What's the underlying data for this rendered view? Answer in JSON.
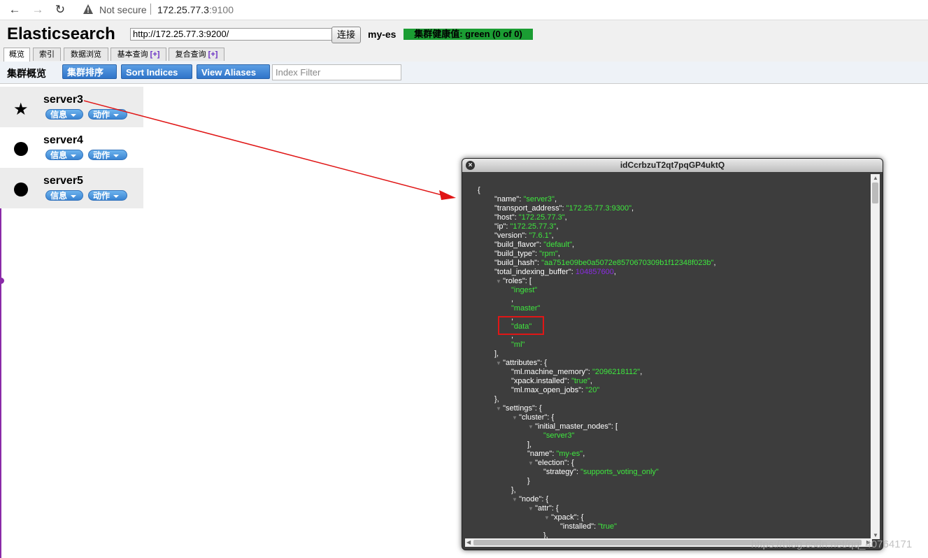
{
  "browser": {
    "security_label": "Not secure",
    "url_host": "172.25.77.3",
    "url_port": ":9100"
  },
  "header": {
    "title": "Elasticsearch",
    "connection_url": "http://172.25.77.3:9200/",
    "connect_label": "连接",
    "cluster_name": "my-es",
    "health": "集群健康值: green (0 of 0)"
  },
  "tabs": [
    {
      "label": "概览"
    },
    {
      "label": "索引"
    },
    {
      "label": "数据浏览"
    },
    {
      "label": "基本查询",
      "plus": "[+]"
    },
    {
      "label": "复合查询",
      "plus": "[+]"
    }
  ],
  "toolbar": {
    "title": "集群概览",
    "sort_cluster": "集群排序",
    "sort_indices": "Sort Indices",
    "view_aliases": "View Aliases",
    "filter_placeholder": "Index Filter"
  },
  "nodes": [
    {
      "name": "server3",
      "info": "信息",
      "action": "动作",
      "icon": "star-icon"
    },
    {
      "name": "server4",
      "info": "信息",
      "action": "动作",
      "icon": "circle-icon"
    },
    {
      "name": "server5",
      "info": "信息",
      "action": "动作",
      "icon": "circle-icon"
    }
  ],
  "dialog": {
    "title": "idCcrbzuT2qt7pqGP4uktQ",
    "lines": [
      "{",
      "\"name\": ",
      "\"server3\"",
      ",",
      "\"transport_address\": ",
      "\"172.25.77.3:9300\"",
      ",",
      "\"host\": ",
      "\"172.25.77.3\"",
      ",",
      "\"ip\": ",
      "\"172.25.77.3\"",
      ",",
      "\"version\": ",
      "\"7.6.1\"",
      ",",
      "\"build_flavor\": ",
      "\"default\"",
      ",",
      "\"build_type\": ",
      "\"rpm\"",
      ",",
      "\"build_hash\": ",
      "\"aa751e09be0a5072e8570670309b1f12348f023b\"",
      ",",
      "\"total_indexing_buffer\": ",
      "104857600",
      ",",
      "\"roles\": [",
      "\"ingest\"",
      ",",
      "\"master\"",
      ",",
      "\"data\"",
      ",",
      "\"ml\"",
      "],",
      "\"attributes\": {",
      "\"ml.machine_memory\": ",
      "\"2096218112\"",
      ",",
      "\"xpack.installed\": ",
      "\"true\"",
      ",",
      "\"ml.max_open_jobs\": ",
      "\"20\"",
      "},",
      "\"settings\": {",
      "\"cluster\": {",
      "\"initial_master_nodes\": [",
      "\"server3\"",
      "],",
      "\"name\": ",
      "\"my-es\"",
      ",",
      "\"election\": {",
      "\"strategy\": ",
      "\"supports_voting_only\"",
      "}",
      "},",
      "\"node\": {",
      "\"attr\": {",
      "\"xpack\": {",
      "\"installed\": ",
      "\"true\"",
      "},"
    ]
  },
  "watermark": "https://blog.csdn.net/qq_40764171",
  "colors": {
    "health_green": "#1b9d33",
    "button_blue": "#2f74c9",
    "json_string": "#3ee83e",
    "json_number": "#8a2be2",
    "highlight_red": "#e01616"
  }
}
